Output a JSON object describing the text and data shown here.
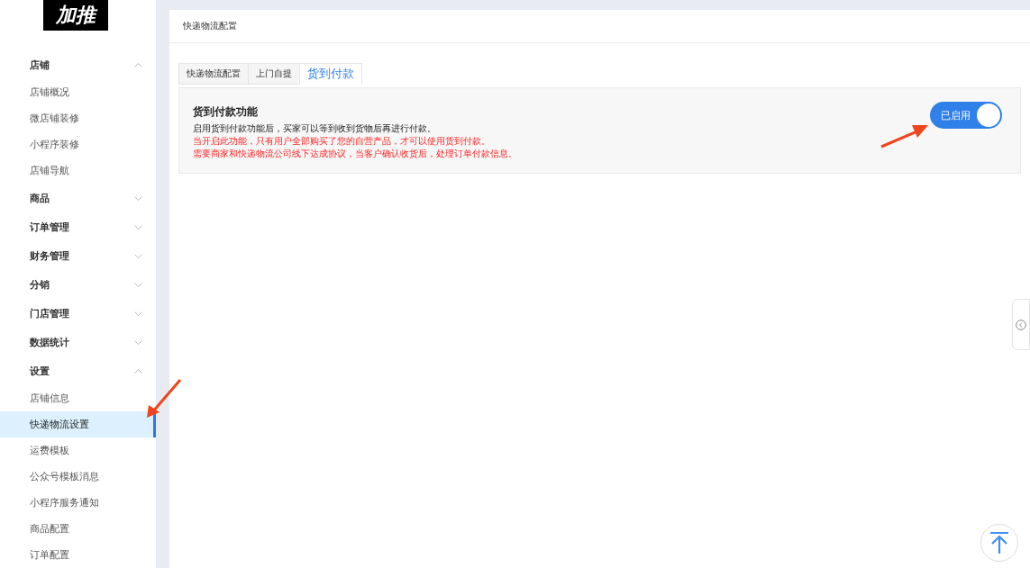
{
  "logo": {
    "text": "加推"
  },
  "sidebar": {
    "items": [
      {
        "label": "店铺",
        "expanded": true,
        "children": [
          {
            "label": "店铺概况",
            "selected": false
          },
          {
            "label": "微店铺装修",
            "selected": false
          },
          {
            "label": "小程序装修",
            "selected": false
          },
          {
            "label": "店铺导航",
            "selected": false
          }
        ]
      },
      {
        "label": "商品",
        "expanded": false
      },
      {
        "label": "订单管理",
        "expanded": false
      },
      {
        "label": "财务管理",
        "expanded": false
      },
      {
        "label": "分销",
        "expanded": false
      },
      {
        "label": "门店管理",
        "expanded": false
      },
      {
        "label": "数据统计",
        "expanded": false
      },
      {
        "label": "设置",
        "expanded": true,
        "children": [
          {
            "label": "店铺信息",
            "selected": false
          },
          {
            "label": "快递物流设置",
            "selected": true
          },
          {
            "label": "运费模板",
            "selected": false
          },
          {
            "label": "公众号模板消息",
            "selected": false
          },
          {
            "label": "小程序服务通知",
            "selected": false
          },
          {
            "label": "商品配置",
            "selected": false
          },
          {
            "label": "订单配置",
            "selected": false
          }
        ]
      }
    ]
  },
  "page": {
    "title": "快递物流配置"
  },
  "tabs": [
    {
      "label": "快递物流配置",
      "selected": false
    },
    {
      "label": "上门自提",
      "selected": false
    },
    {
      "label": "货到付款",
      "selected": true
    }
  ],
  "feature": {
    "title": "货到付款功能",
    "lines": [
      {
        "text": "启用货到付款功能后，买家可以等到收到货物后再进行付款。",
        "kind": "info"
      },
      {
        "text": "当开启此功能，只有用户全部购买了您的自营产品，才可以使用货到付款。",
        "kind": "warning"
      },
      {
        "text": "需要商家和快递物流公司线下达成协议，当客户确认收货后，处理订单付款信息。",
        "kind": "warning"
      }
    ],
    "toggle": {
      "label": "已启用",
      "on": true
    }
  }
}
